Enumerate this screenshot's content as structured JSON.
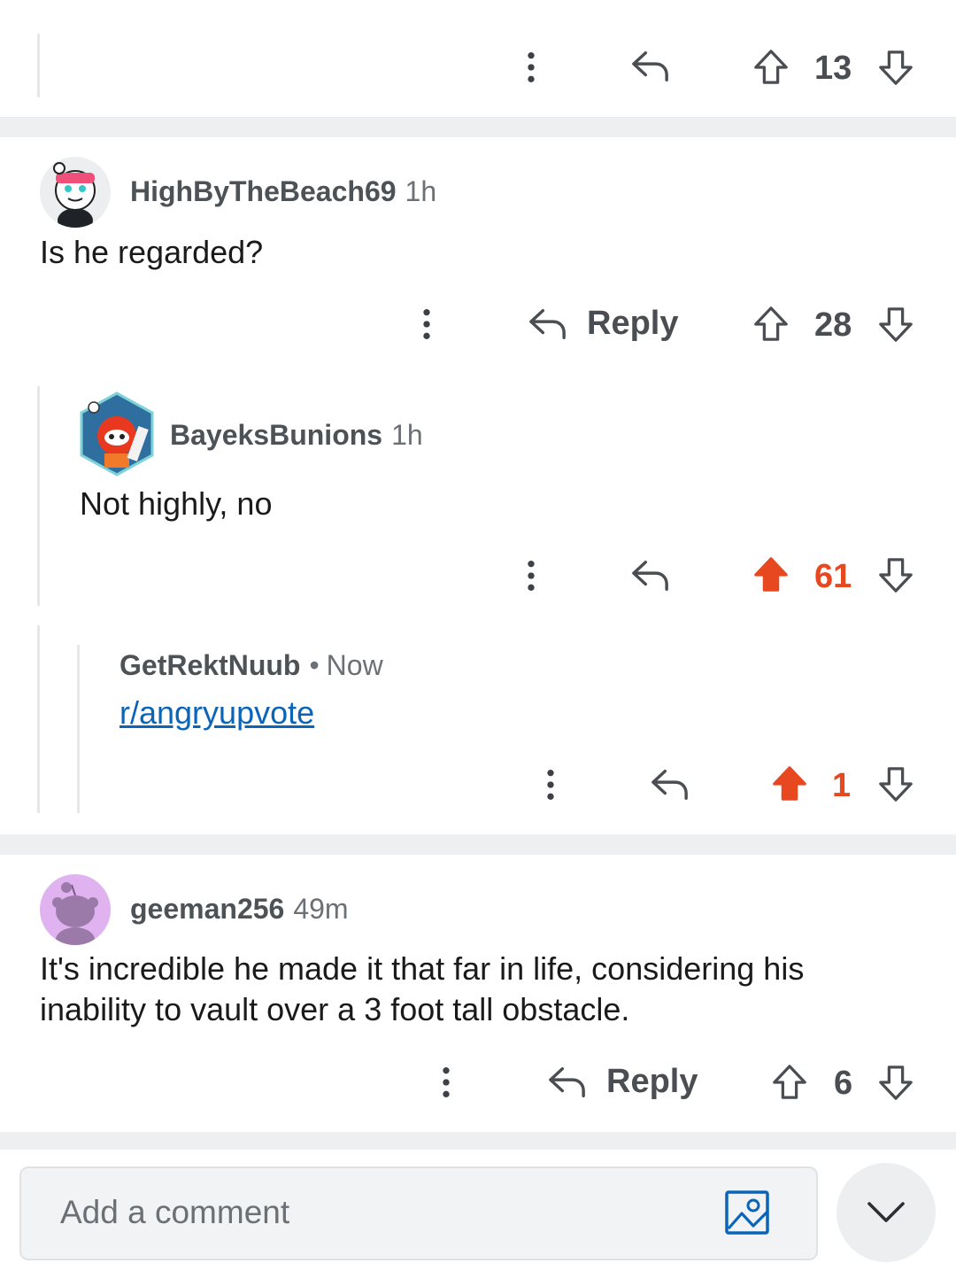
{
  "top_bar": {
    "score": "13"
  },
  "comments": [
    {
      "username": "HighByTheBeach69",
      "time": "1h",
      "body": "Is he regarded?",
      "reply_label": "Reply",
      "score": "28"
    },
    {
      "username": "BayeksBunions",
      "time": "1h",
      "body": "Not highly, no",
      "score": "61",
      "upvoted": true
    },
    {
      "username": "GetRektNuub",
      "separator": "•",
      "time": "Now",
      "link_text": "r/angryupvote",
      "score": "1",
      "upvoted": true
    },
    {
      "username": "geeman256",
      "time": "49m",
      "body": "It's incredible he made it that far in life, considering his inability to vault over a 3 foot tall obstacle.",
      "reply_label": "Reply",
      "score": "6"
    }
  ],
  "composer": {
    "placeholder": "Add a comment"
  },
  "icons": [
    "more-vertical-icon",
    "reply-arrow-icon",
    "upvote-arrow-icon",
    "downvote-arrow-icon",
    "image-icon",
    "chevron-down-icon"
  ],
  "colors": {
    "upvote": "#e8481f",
    "link": "#0a64b7",
    "separator": "#eeeff1"
  }
}
